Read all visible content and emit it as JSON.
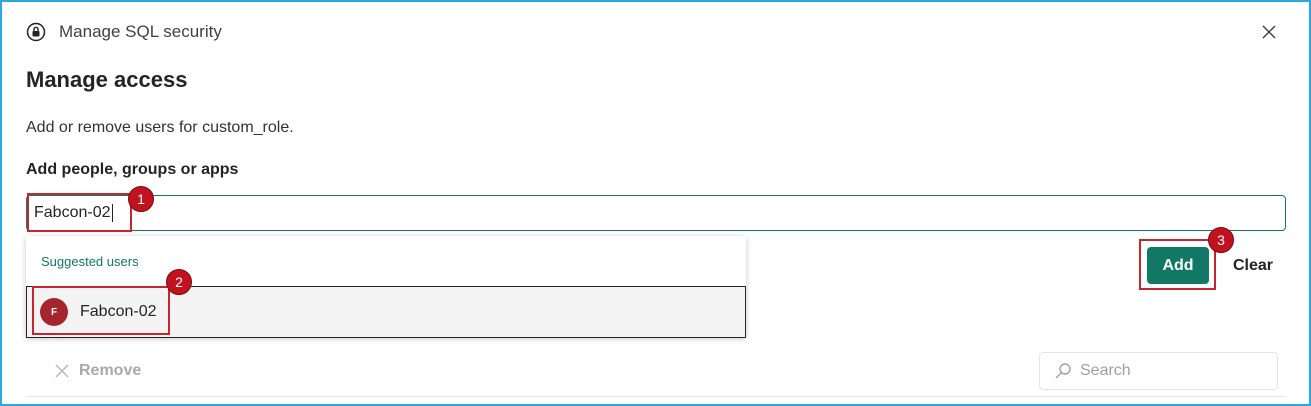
{
  "header": {
    "title": "Manage SQL security",
    "icon": "lock-icon",
    "close_icon": "close-icon"
  },
  "page": {
    "title": "Manage access",
    "description": "Add or remove users for custom_role.",
    "field_label": "Add people, groups or apps"
  },
  "people_input": {
    "value": "Fabcon-02"
  },
  "suggestions": {
    "header": "Suggested users",
    "items": [
      {
        "initial": "F",
        "name": "Fabcon-02"
      }
    ]
  },
  "actions": {
    "add_label": "Add",
    "clear_label": "Clear"
  },
  "toolbar": {
    "remove_label": "Remove",
    "search_placeholder": "Search"
  },
  "annotations": {
    "step1": "1",
    "step2": "2",
    "step3": "3"
  },
  "colors": {
    "accent": "#117865",
    "highlight": "#c4262e",
    "avatar": "#a4262c",
    "frame": "#2aa8df"
  }
}
